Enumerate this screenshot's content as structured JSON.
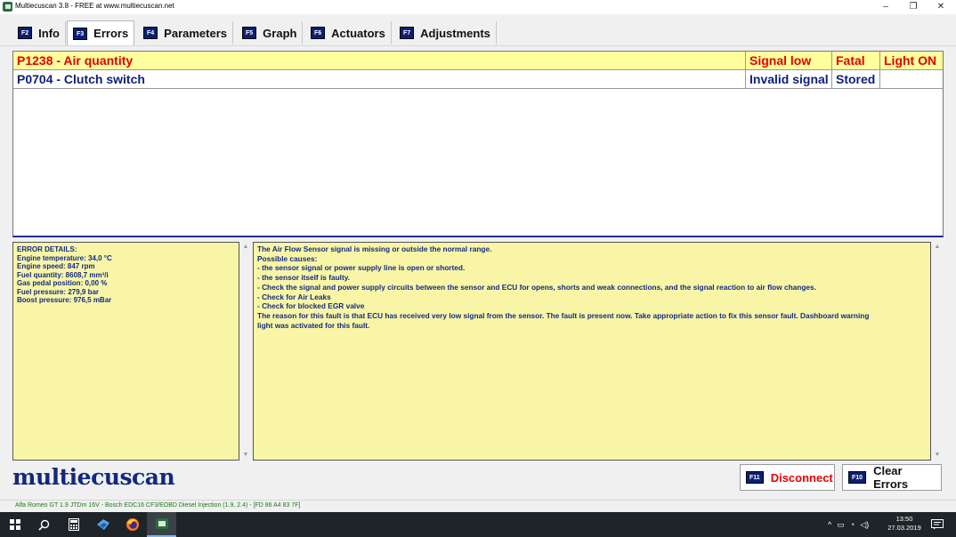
{
  "window": {
    "title": "Multiecuscan 3.8 - FREE at www.multiecuscan.net",
    "minimize_glyph": "–",
    "maximize_glyph": "❐",
    "close_glyph": "✕"
  },
  "tabs": [
    {
      "fkey": "F2",
      "label": "Info",
      "active": false
    },
    {
      "fkey": "F3",
      "label": "Errors",
      "active": true
    },
    {
      "fkey": "F4",
      "label": "Parameters",
      "active": false
    },
    {
      "fkey": "F5",
      "label": "Graph",
      "active": false
    },
    {
      "fkey": "F6",
      "label": "Actuators",
      "active": false
    },
    {
      "fkey": "F7",
      "label": "Adjustments",
      "active": false
    }
  ],
  "errors": [
    {
      "code": "P1238 - Air quantity",
      "type": "Signal low",
      "severity": "Fatal",
      "status": "Light ON"
    },
    {
      "code": "P0704 - Clutch switch",
      "type": "Invalid signal",
      "severity": "Stored",
      "status": ""
    }
  ],
  "details": {
    "heading": "ERROR DETAILS:",
    "lines": [
      "Engine temperature: 34,0 °C",
      "Engine speed: 847 rpm",
      "Fuel quantity: 8608,7 mm³/i",
      "Gas pedal position: 0,00 %",
      "Fuel pressure: 279,9 bar",
      "Boost pressure: 976,5 mBar"
    ]
  },
  "description": {
    "lines": [
      "The Air Flow Sensor signal is missing or outside the normal range.",
      "Possible causes:",
      "- the sensor signal or power supply line is open or shorted.",
      "- the sensor itself is faulty.",
      "- Check the signal and power supply circuits between the sensor and ECU for opens, shorts and weak connections, and the signal reaction to air flow changes.",
      "- Check for Air Leaks",
      "- Check for blocked EGR valve",
      "The reason for this fault is that ECU has received very low signal from the sensor. The fault is present now. Take appropriate action to fix this sensor fault. Dashboard warning",
      "light was activated for this fault."
    ]
  },
  "logo": "multiecuscan",
  "buttons": {
    "disconnect": {
      "fkey": "F11",
      "label": "Disconnect"
    },
    "clear_errors": {
      "fkey": "F10",
      "label": "Clear Errors"
    }
  },
  "status_bar": "Alfa Romeo GT 1.9 JTDm 16V - Bosch EDC16 CF3/EOBD Diesel Injection (1.9, 2.4) - [FD 86 A4 83 7F]",
  "taskbar": {
    "time": "13:50",
    "date": "27.03.2019"
  },
  "colors": {
    "active_error": "#e40000",
    "stored_error": "#0e1f7c",
    "highlight_row": "#ffff9e",
    "panel_bg": "#f8f6a6",
    "fkey_badge": "#0b1f74",
    "logo": "#14287e",
    "status_text": "#1c7a16"
  }
}
